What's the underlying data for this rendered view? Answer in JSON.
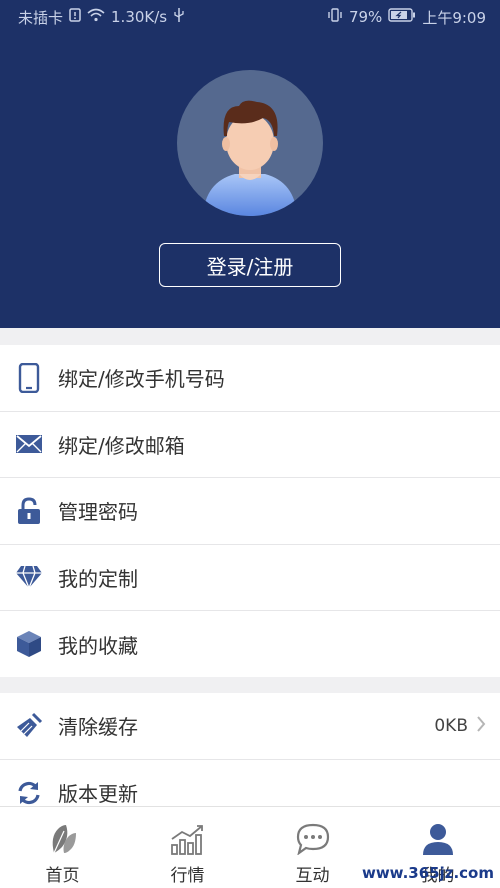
{
  "status_bar": {
    "carrier": "未插卡",
    "speed": "1.30K/s",
    "battery": "79%",
    "time": "上午9:09"
  },
  "header": {
    "login_button": "登录/注册",
    "background_color": "#1d3167"
  },
  "menu_group_1": [
    {
      "label": "绑定/修改手机号码",
      "icon": "phone-icon"
    },
    {
      "label": "绑定/修改邮箱",
      "icon": "mail-icon"
    },
    {
      "label": "管理密码",
      "icon": "lock-icon"
    },
    {
      "label": "我的定制",
      "icon": "diamond-icon"
    },
    {
      "label": "我的收藏",
      "icon": "cube-icon"
    }
  ],
  "menu_group_2": [
    {
      "label": "清除缓存",
      "icon": "broom-icon",
      "value": "0KB"
    },
    {
      "label": "版本更新",
      "icon": "refresh-icon"
    }
  ],
  "tabbar": [
    {
      "label": "首页",
      "icon": "leaf-icon"
    },
    {
      "label": "行情",
      "icon": "chart-icon"
    },
    {
      "label": "互动",
      "icon": "chat-icon"
    },
    {
      "label": "我的",
      "icon": "user-icon"
    }
  ],
  "watermark": "www.365jz.com",
  "accent_color": "#3d5a99"
}
